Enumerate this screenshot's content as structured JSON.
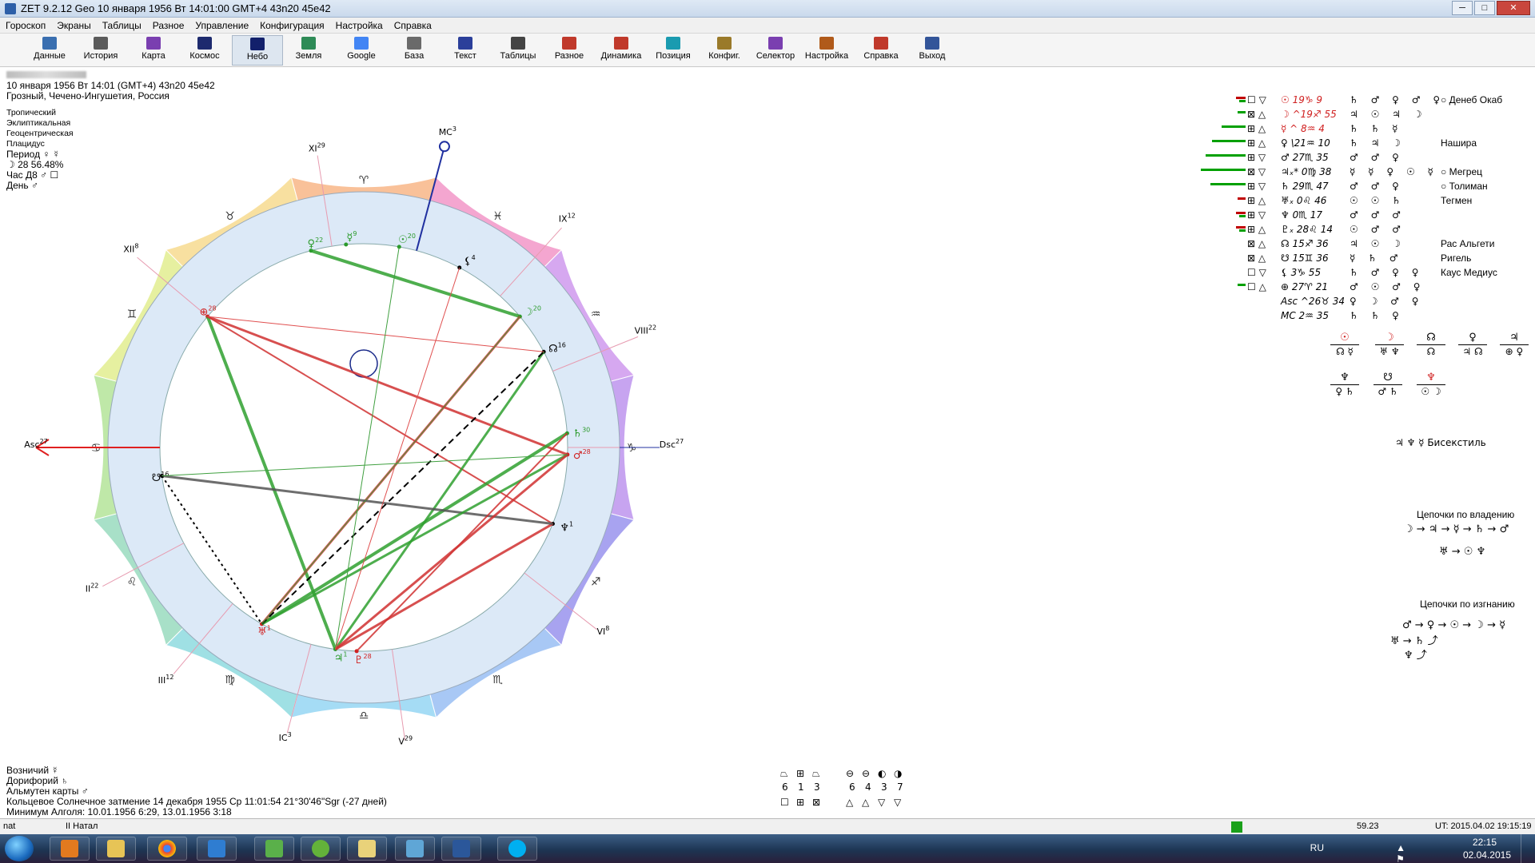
{
  "window": {
    "title": "ZET 9.2.12 Geo    10 января 1956  Вт  14:01:00 GMT+4 43n20  45e42",
    "minimize": "─",
    "maximize": "□",
    "close": "✕"
  },
  "menu": [
    "Гороскоп",
    "Экраны",
    "Таблицы",
    "Разное",
    "Управление",
    "Конфигурация",
    "Настройка",
    "Справка"
  ],
  "toolbar": [
    {
      "label": "Данные",
      "icon": "data-icon",
      "color": "#3a6fb0"
    },
    {
      "label": "История",
      "icon": "history-icon",
      "color": "#5b5b5b"
    },
    {
      "label": "Карта",
      "icon": "map-icon",
      "color": "#7a3fb0"
    },
    {
      "label": "Космос",
      "icon": "cosmos-icon",
      "color": "#1d2a6e"
    },
    {
      "label": "Небо",
      "icon": "sky-icon",
      "color": "#12206b"
    },
    {
      "label": "Земля",
      "icon": "earth-icon",
      "color": "#2e8b57"
    },
    {
      "label": "Google",
      "icon": "google-icon",
      "color": "#4285f4"
    },
    {
      "label": "База",
      "icon": "database-icon",
      "color": "#6a6a6a"
    },
    {
      "label": "Текст",
      "icon": "text-icon",
      "color": "#2b3f9a"
    },
    {
      "label": "Таблицы",
      "icon": "tables-icon",
      "color": "#444444"
    },
    {
      "label": "Разное",
      "icon": "misc-icon",
      "color": "#c0392b"
    },
    {
      "label": "Динамика",
      "icon": "dynamics-icon",
      "color": "#c0392b"
    },
    {
      "label": "Позиция",
      "icon": "position-icon",
      "color": "#1a9bb0"
    },
    {
      "label": "Конфиг.",
      "icon": "config-icon",
      "color": "#9a7a2a"
    },
    {
      "label": "Селектор",
      "icon": "selector-icon",
      "color": "#7a3fb0"
    },
    {
      "label": "Настройка",
      "icon": "settings-icon",
      "color": "#b05a1a"
    },
    {
      "label": "Справка",
      "icon": "help-icon",
      "color": "#c0392b"
    },
    {
      "label": "Выход",
      "icon": "exit-icon",
      "color": "#335599"
    }
  ],
  "info": {
    "date_line": "10 января 1956  Вт  14:01 (GMT+4) 43n20  45e42",
    "place": "Грозный, Чечено-Ингушетия, Россия",
    "zodiac": "Тропический",
    "coords": "Эклиптикальная",
    "center": "Геоцентрическая",
    "houses": "Плацидус",
    "period": "Период  ♀  ☿",
    "moon": "☽  28 56.48%",
    "hour": "Час Д8  ♂  ☐",
    "day": "День  ♂"
  },
  "bottom_info": {
    "voznichiy": "Возничий  ☿",
    "doriforiy": "Дорифорий  ♄",
    "almuten": "Альмутен карты  ♂",
    "eclipse": "Кольцевое Солнечное затмение 14 декабря 1955 Ср 11:01:54 21°30'46\"Sgr (-27 дней)",
    "algol": "Минимум Алголя: 10.01.1956  6:29,  13.01.1956  3:18"
  },
  "chart_wheel": {
    "house_labels": [
      {
        "label": "XI",
        "deg": "29"
      },
      {
        "label": "MC",
        "deg": "3"
      },
      {
        "label": "IX",
        "deg": "12"
      },
      {
        "label": "VIII",
        "deg": "22"
      },
      {
        "label": "Dsc",
        "deg": "27"
      },
      {
        "label": "VI",
        "deg": "8"
      },
      {
        "label": "V",
        "deg": "29"
      },
      {
        "label": "IC",
        "deg": "3"
      },
      {
        "label": "III",
        "deg": "12"
      },
      {
        "label": "II",
        "deg": "22"
      },
      {
        "label": "Asc",
        "deg": "27"
      },
      {
        "label": "XII",
        "deg": "8"
      }
    ],
    "signs": [
      "♓",
      "♒",
      "♑",
      "♐",
      "♏",
      "♎",
      "♍",
      "♌",
      "♋",
      "♊",
      "♉",
      "♈"
    ],
    "planets": [
      {
        "glyph": "♀",
        "deg": "22",
        "color": "#2a9a2a"
      },
      {
        "glyph": "☿",
        "deg": "9",
        "color": "#2a9a2a"
      },
      {
        "glyph": "☉",
        "deg": "20",
        "color": "#2a9a2a"
      },
      {
        "glyph": "⚸",
        "deg": "4",
        "color": "#000000"
      },
      {
        "glyph": "☽",
        "deg": "20",
        "color": "#2a9a2a"
      },
      {
        "glyph": "☊",
        "deg": "16",
        "color": "#000000"
      },
      {
        "glyph": "♄",
        "deg": "30",
        "color": "#2a9a2a"
      },
      {
        "glyph": "♂",
        "deg": "28",
        "color": "#d02020"
      },
      {
        "glyph": "♆",
        "deg": "1",
        "color": "#000000"
      },
      {
        "glyph": "⊕",
        "deg": "28",
        "color": "#d02020"
      },
      {
        "glyph": "☋",
        "deg": "16",
        "color": "#000000"
      },
      {
        "glyph": "♅",
        "deg": "1",
        "color": "#d02020"
      },
      {
        "glyph": "♃",
        "deg": "1",
        "color": "#2a9a2a"
      },
      {
        "glyph": "♇",
        "deg": "28",
        "color": "#d02020"
      }
    ]
  },
  "aspect_table": [
    {
      "bars": [
        "#c00000",
        "#00a000"
      ],
      "glyphs": "☐ ▽",
      "pos": "☉  19♑  9",
      "rulers": "♄ ♂ ♀ ♂ ♀",
      "star": "○  Денеб Окаб",
      "pc": "#d02020"
    },
    {
      "bars": [
        "#00a000"
      ],
      "glyphs": "⊠ △",
      "pos": "☽  ^19♐ 55",
      "rulers": "♃ ☉ ♃ ☽",
      "star": "",
      "pc": "#d02020"
    },
    {
      "bars": [
        "#00a000"
      ],
      "glyphs": "⊞ △",
      "pos": "☿  ^ 8♒  4",
      "rulers": "♄ ♄ ☿",
      "star": "",
      "pc": "#d02020"
    },
    {
      "bars": [
        "#00a000"
      ],
      "glyphs": "⊞ △",
      "pos": "♀  \\21♒ 10",
      "rulers": "♄ ♃ ☽",
      "star": "Нашира",
      "pc": "#000000"
    },
    {
      "bars": [
        "#00a000"
      ],
      "glyphs": "⊞ ▽",
      "pos": "♂  27♏ 35",
      "rulers": "♂ ♂ ♀",
      "star": "",
      "pc": "#000000"
    },
    {
      "bars": [
        "#00a000"
      ],
      "glyphs": "⊠ ▽",
      "pos": "♃ₓ* 0♍ 38",
      "rulers": "☿ ☿ ♀ ☉ ☿",
      "star": "○  Мегрец",
      "pc": "#000000"
    },
    {
      "bars": [
        "#00a000"
      ],
      "glyphs": "⊞ ▽",
      "pos": "♄  29♏ 47",
      "rulers": "♂ ♂ ♀",
      "star": "○  Толиман",
      "pc": "#000000"
    },
    {
      "bars": [
        "#c00000"
      ],
      "glyphs": "⊞ △",
      "pos": "♅ₓ  0♌ 46",
      "rulers": "☉ ☉ ♄",
      "star": "Тегмен",
      "pc": "#000000"
    },
    {
      "bars": [
        "#c00000",
        "#00a000"
      ],
      "glyphs": "⊞ ▽",
      "pos": "♆  0♏ 17",
      "rulers": "♂ ♂ ♂",
      "star": "",
      "pc": "#000000"
    },
    {
      "bars": [
        "#c00000",
        "#00a000"
      ],
      "glyphs": "⊞ △",
      "pos": "♇ₓ 28♌ 14",
      "rulers": "☉ ♂ ♂",
      "star": "",
      "pc": "#000000"
    },
    {
      "bars": [],
      "glyphs": "⊠ △",
      "pos": "☊  15♐ 36",
      "rulers": "♃ ☉ ☽",
      "star": "Рас Альгети",
      "pc": "#000000"
    },
    {
      "bars": [],
      "glyphs": "⊠ △",
      "pos": "☋  15♊ 36",
      "rulers": "☿ ♄ ♂",
      "star": "Ригель",
      "pc": "#000000"
    },
    {
      "bars": [],
      "glyphs": "☐ ▽",
      "pos": "⚸  3♑ 55",
      "rulers": "♄ ♂ ♀ ♀",
      "star": "Каус Медиус",
      "pc": "#000000"
    },
    {
      "bars": [
        "#00a000"
      ],
      "glyphs": "☐ △",
      "pos": "⊕  27♈ 21",
      "rulers": "♂ ☉ ♂ ♀",
      "star": "",
      "pc": "#000000"
    },
    {
      "bars": [],
      "glyphs": "",
      "pos": "Asc ^26♉ 34",
      "rulers": "♀ ☽ ♂ ♀",
      "star": "",
      "pc": "#000000"
    },
    {
      "bars": [],
      "glyphs": "",
      "pos": "MC  2♒ 35",
      "rulers": "♄ ♄ ♀",
      "star": "",
      "pc": "#000000"
    }
  ],
  "mini_groups": [
    "☉",
    "☽",
    "☊",
    "♀",
    "♃",
    "♆",
    "☋",
    "♆"
  ],
  "bisextile": "♃ ♆ ☿  Бисекстиль",
  "chains_ownership": {
    "title": "Цепочки по владению",
    "line1": "☽ → ♃ → ☿ → ♄ → ♂",
    "line2": "♅ → ☉    ♆"
  },
  "chains_exile": {
    "title": "Цепочки по изгнанию",
    "line1": "♂ → ♀ → ☉ → ☽ → ☿",
    "line2": "♅ → ♄ ⤴",
    "line3": "♆ ⤴"
  },
  "footer_stats": {
    "icons1": [
      "⏢",
      "⊞",
      "⏢"
    ],
    "nums1": [
      "6",
      "1",
      "3"
    ],
    "icons2": [
      "⊖",
      "⊖",
      "◐",
      "◑"
    ],
    "nums2": [
      "6",
      "4",
      "3",
      "7"
    ]
  },
  "status": {
    "left": "nat",
    "natal": "II Натал",
    "value": "59.23",
    "ut": "UT: 2015.04.02 19:15:19"
  },
  "tray": {
    "lang": "RU",
    "time": "22:15",
    "date": "02.04.2015"
  }
}
